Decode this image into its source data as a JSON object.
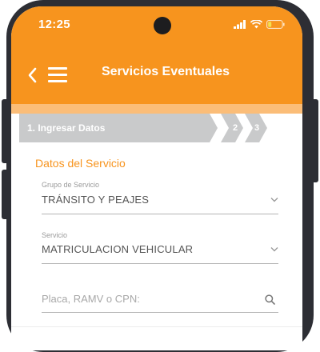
{
  "status_bar": {
    "time": "12:25"
  },
  "app_bar": {
    "title": "Servicios Eventuales"
  },
  "stepper": {
    "steps": [
      {
        "label": "1. Ingresar Datos",
        "active": true
      },
      {
        "label": "2",
        "active": false
      },
      {
        "label": "3",
        "active": false
      }
    ]
  },
  "form": {
    "section_title": "Datos del Servicio",
    "grupo": {
      "label": "Grupo de Servicio",
      "value": "TRÁNSITO Y PEAJES"
    },
    "servicio": {
      "label": "Servicio",
      "value": "MATRICULACION VEHICULAR"
    },
    "search": {
      "placeholder": "Placa, RAMV o CPN:",
      "value": ""
    }
  },
  "colors": {
    "accent": "#f7941e",
    "accent_light": "#fbbd78",
    "stepper": "#c9cacb",
    "frame": "#2d2e34"
  },
  "icons": [
    "back-chevron-icon",
    "hamburger-menu-icon",
    "signal-icon",
    "wifi-icon",
    "battery-icon",
    "chevron-down-icon",
    "search-icon"
  ]
}
